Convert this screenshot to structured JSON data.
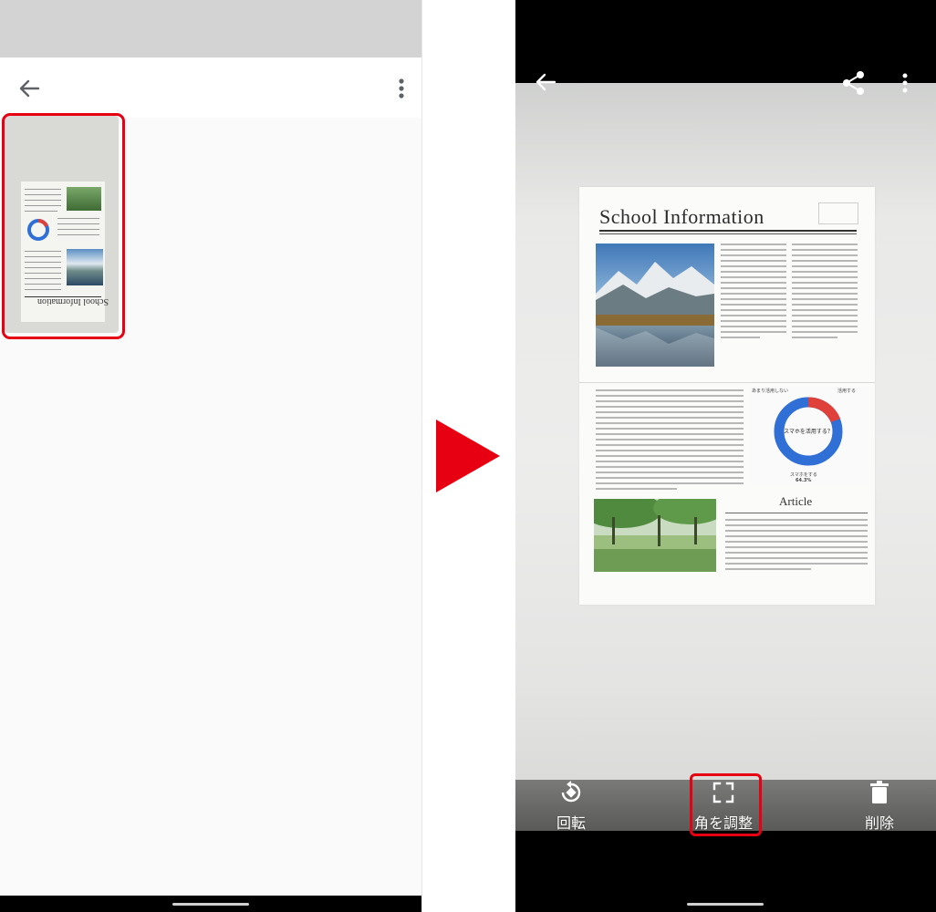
{
  "left_screen": {
    "thumbnail": {
      "title_text": "School Information"
    }
  },
  "right_screen": {
    "document": {
      "title": "School Information",
      "article_heading": "Article",
      "chart_center_label": "スマホを活用する？",
      "chart_left_label": "あまり活用しない",
      "chart_left_sub": "",
      "chart_right_label": "活用する",
      "chart_bottom_label": "スマホをする",
      "chart_bottom_pct": "64.3%",
      "accent_red": "#e0403a",
      "accent_blue": "#2f6fd6"
    },
    "toolbar": {
      "rotate_label": "回転",
      "adjust_corners_label": "角を調整",
      "delete_label": "削除"
    }
  },
  "annotation": {
    "highlight_color": "#e60012",
    "arrow_color": "#e60012"
  }
}
